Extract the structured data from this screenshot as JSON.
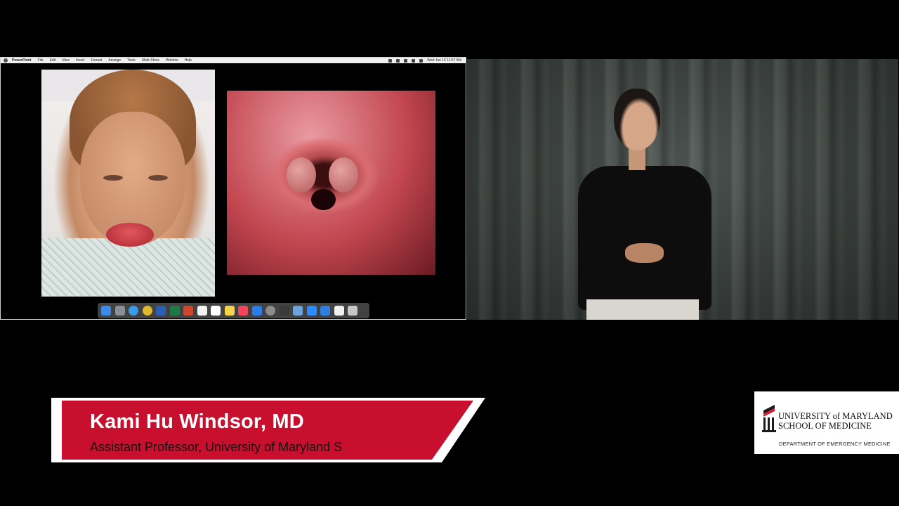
{
  "screen_share": {
    "menubar": {
      "app_name": "PowerPoint",
      "items": [
        "File",
        "Edit",
        "View",
        "Insert",
        "Format",
        "Arrange",
        "Tools",
        "Slide Show",
        "Window",
        "Help"
      ],
      "clock": "Wed Jun 16 11:57 AM"
    },
    "dock_icons": [
      "finder-icon",
      "launchpad-icon",
      "safari-icon",
      "chrome-icon",
      "word-icon",
      "excel-icon",
      "powerpoint-icon",
      "photos-icon",
      "calendar-icon",
      "notes-icon",
      "music-icon",
      "app-store-icon",
      "system-preferences-icon",
      "phone-icon",
      "preview-icon",
      "zoom-icon",
      "keynote-icon",
      "document-icon",
      "trash-icon"
    ],
    "dock_colors": [
      "#3b8be8",
      "#8a8f98",
      "#3a9be8",
      "#e0b92d",
      "#2b5fb5",
      "#1e7a45",
      "#d0452b",
      "#f3f3f3",
      "#ffffff",
      "#f5d34b",
      "#f14659",
      "#2b7de9",
      "#8c8c8c",
      "#3a3a3a",
      "#6aa6dd",
      "#2d8cff",
      "#2f7fe0",
      "#f0f0f0",
      "#c7c7c7"
    ]
  },
  "lower_third": {
    "name": "Kami Hu Windsor, MD",
    "title": "Assistant Professor, University of Maryland S",
    "accent_color": "#c8102e"
  },
  "logo": {
    "line1": "UNIVERSITY of MARYLAND",
    "line2": "SCHOOL OF MEDICINE",
    "line3": "DEPARTMENT OF EMERGENCY MEDICINE"
  }
}
